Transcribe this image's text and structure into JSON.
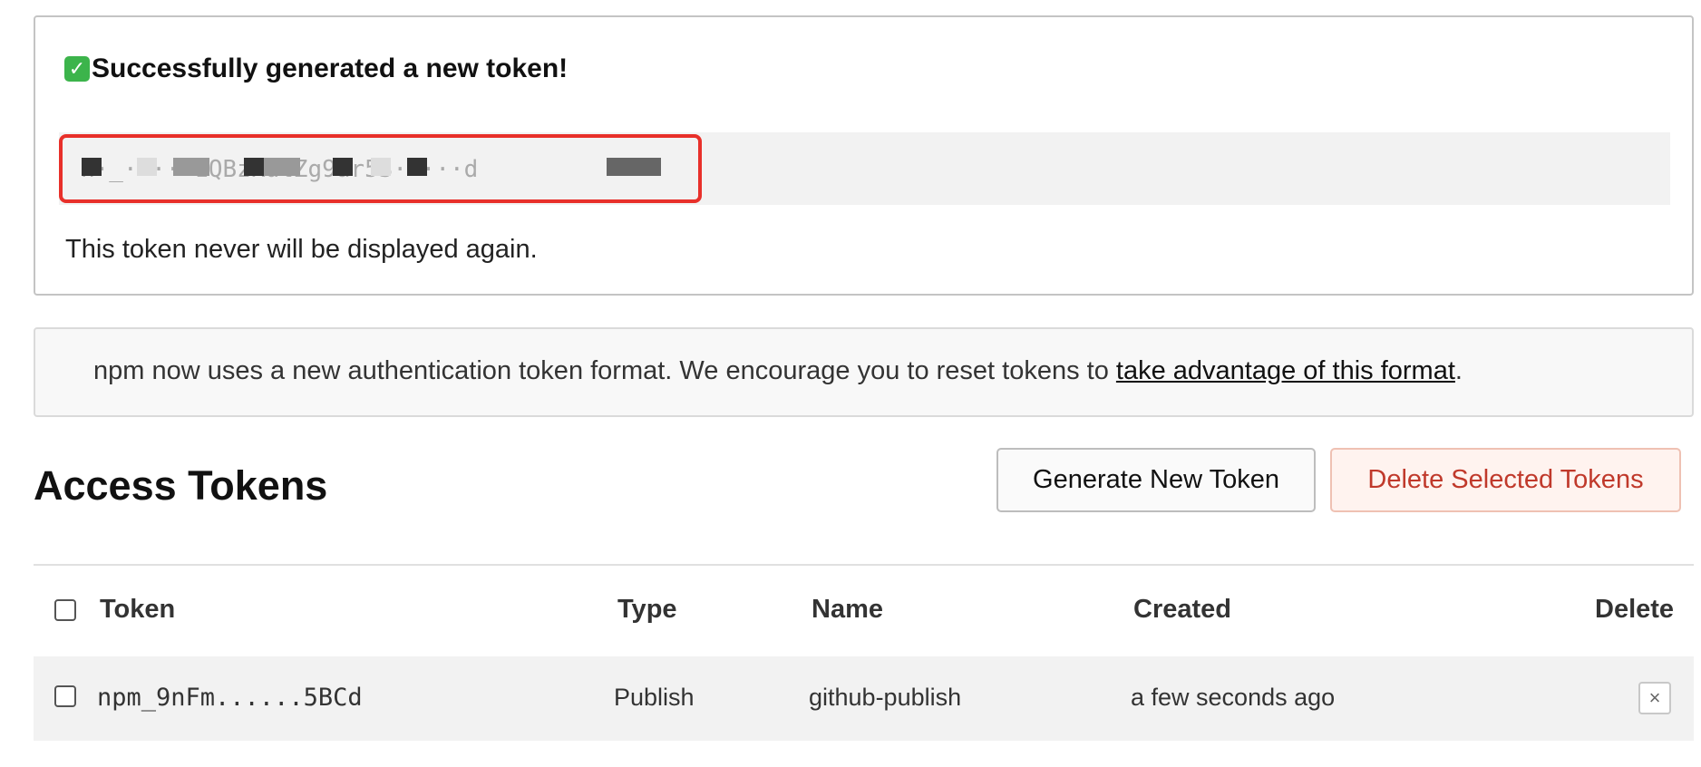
{
  "success": {
    "title": "Successfully generated a new token!",
    "check_icon": "✓",
    "token_value": "n·_·····1QBzKulZg9ar53·····d",
    "note": "This token never will be displayed again."
  },
  "info": {
    "text_before": "npm now uses a new authentication token format. We encourage you to reset tokens to ",
    "link_text": "take advantage of this format",
    "text_after": "."
  },
  "access_tokens": {
    "title": "Access Tokens",
    "generate_button": "Generate New Token",
    "delete_button": "Delete Selected Tokens",
    "columns": [
      "Token",
      "Type",
      "Name",
      "Created",
      "Delete"
    ],
    "rows": [
      {
        "token": "npm_9nFm......5BCd",
        "type": "Publish",
        "name": "github-publish",
        "created": "a few seconds ago",
        "delete_label": "×"
      }
    ]
  },
  "colors": {
    "highlight_border": "#e8302a",
    "success_icon": "#3cb44b",
    "delete_text": "#c0392b"
  }
}
